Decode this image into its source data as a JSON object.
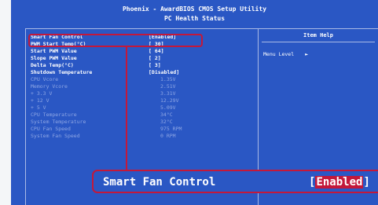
{
  "header": {
    "title_line1": "Phoenix - AwardBIOS CMOS Setup Utility",
    "title_line2": "PC Health Status"
  },
  "settings": [
    {
      "label": "Smart Fan Control",
      "value": "[Enabled]",
      "state": "selected"
    },
    {
      "label": "PWM Start Temp(°C)",
      "value": "[ 30]",
      "state": "on"
    },
    {
      "label": "Start PWM Value",
      "value": "[ 64]",
      "state": "on"
    },
    {
      "label": "Slope PWM Value",
      "value": "[ 2]",
      "state": "on"
    },
    {
      "label": "Delta Temp(°C)",
      "value": "[ 3]",
      "state": "on"
    },
    {
      "label": "Shutdown Temperature",
      "value": "[Disabled]",
      "state": "on"
    },
    {
      "label": "CPU Vcore",
      "value": "1.35V",
      "state": "dim"
    },
    {
      "label": "Memory Vcore",
      "value": "2.51V",
      "state": "dim"
    },
    {
      "label": "+ 3.3 V",
      "value": "3.31V",
      "state": "dim"
    },
    {
      "label": "+ 12 V",
      "value": "12.29V",
      "state": "dim"
    },
    {
      "label": "+ 5 V",
      "value": "5.09V",
      "state": "dim"
    },
    {
      "label": "CPU Temperature",
      "value": "34°C",
      "state": "dim"
    },
    {
      "label": "System Temperature",
      "value": "32°C",
      "state": "dim"
    },
    {
      "label": "CPU Fan Speed",
      "value": "975 RPM",
      "state": "dim"
    },
    {
      "label": "System Fan Speed",
      "value": "0 RPM",
      "state": "dim"
    }
  ],
  "help": {
    "title": "Item Help",
    "menu_level_label": "Menu Level",
    "menu_level_arrow": "►"
  },
  "zoom": {
    "label": "Smart Fan Control",
    "bracket_open": "[",
    "value": "Enabled",
    "bracket_close": "]"
  },
  "colors": {
    "bios_blue": "#2a57c4",
    "highlight_red": "#c3183a",
    "text_white": "#ffffff",
    "text_dim": "#8ea6e4"
  }
}
